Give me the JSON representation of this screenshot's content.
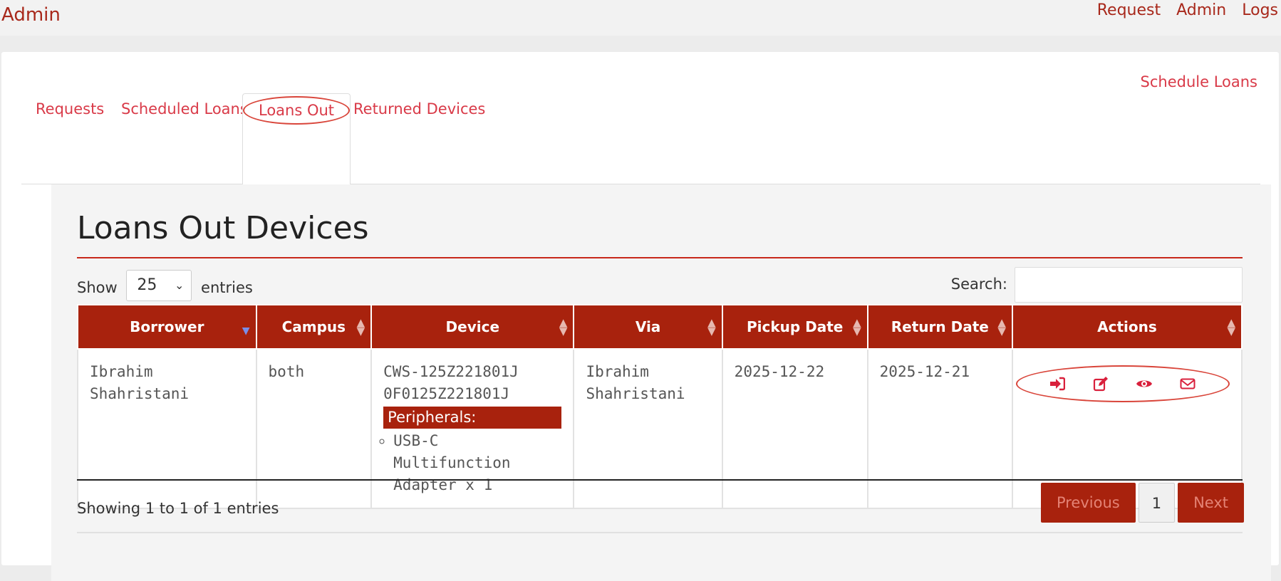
{
  "header": {
    "brand": "Admin",
    "nav": [
      "Request",
      "Admin",
      "Logs"
    ]
  },
  "schedule_loans": "Schedule Loans",
  "tabs": [
    {
      "label": "Requests"
    },
    {
      "label": "Scheduled Loans"
    },
    {
      "label": "Loans Out"
    },
    {
      "label": "Returned Devices"
    }
  ],
  "panel": {
    "title": "Loans Out Devices",
    "show_label": "Show",
    "entries_value": "25",
    "entries_label": "entries",
    "search_label": "Search:",
    "search_value": ""
  },
  "table": {
    "headers": [
      "Borrower",
      "Campus",
      "Device",
      "Via",
      "Pickup Date",
      "Return Date",
      "Actions"
    ],
    "rows": [
      {
        "borrower": "Ibrahim Shahristani",
        "campus": "both",
        "device_line1": "CWS-125Z221801J",
        "device_line2": "0F0125Z221801J",
        "peripherals_label": "Peripherals:",
        "peripheral_item": "USB-C Multifunction Adapter x 1",
        "via": "Ibrahim Shahristani",
        "pickup_date": "2025-12-22",
        "return_date": "2025-12-21"
      }
    ]
  },
  "footer": {
    "info": "Showing 1 to 1 of 1 entries",
    "previous": "Previous",
    "page": "1",
    "next": "Next"
  },
  "colors": {
    "accent": "#a8220d",
    "link": "#d93a48",
    "highlight": "#d9453a"
  },
  "icons": [
    "sign-in-icon",
    "edit-icon",
    "eye-icon",
    "envelope-icon"
  ]
}
